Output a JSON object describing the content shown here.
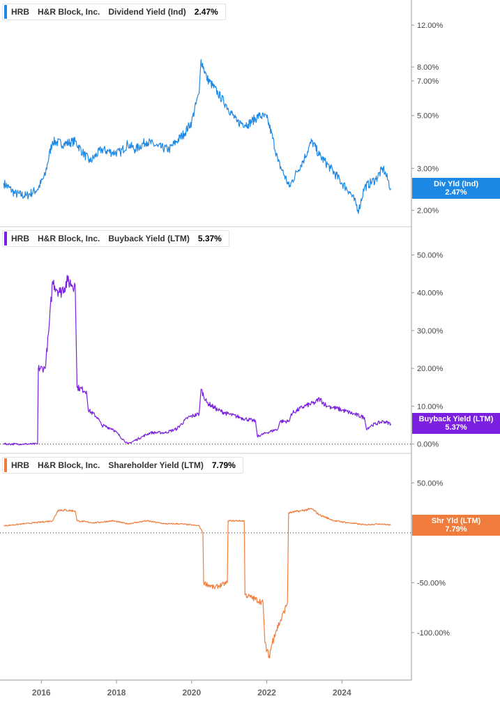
{
  "chart_data": [
    {
      "type": "line",
      "ticker": "HRB",
      "company": "H&R Block, Inc.",
      "metric": "Dividend Yield (Ind)",
      "current_value": "2.47%",
      "badge_label": "Div Yld (Ind)",
      "badge_value": "2.47%",
      "color": "#1e88e5",
      "scale": "log",
      "ylim": [
        1.8,
        14.5
      ],
      "yticks": [
        {
          "v": 12,
          "label": "12.00%"
        },
        {
          "v": 8,
          "label": "8.00%"
        },
        {
          "v": 7,
          "label": "7.00%"
        },
        {
          "v": 5,
          "label": "5.00%"
        },
        {
          "v": 3,
          "label": "3.00%"
        },
        {
          "v": 2,
          "label": "2.00%"
        }
      ],
      "x": [
        2015.0,
        2015.3,
        2015.6,
        2015.9,
        2016.1,
        2016.3,
        2016.6,
        2016.9,
        2017.1,
        2017.3,
        2017.6,
        2017.9,
        2018.1,
        2018.3,
        2018.5,
        2018.8,
        2019.1,
        2019.4,
        2019.6,
        2019.8,
        2020.0,
        2020.2,
        2020.25,
        2020.4,
        2020.7,
        2020.9,
        2021.2,
        2021.5,
        2021.8,
        2022.0,
        2022.3,
        2022.6,
        2022.8,
        2023.0,
        2023.2,
        2023.4,
        2023.7,
        2024.0,
        2024.2,
        2024.45,
        2024.6,
        2024.9,
        2025.1,
        2025.3
      ],
      "values": [
        2.6,
        2.35,
        2.3,
        2.45,
        2.8,
        3.9,
        3.8,
        3.9,
        3.5,
        3.2,
        3.6,
        3.5,
        3.5,
        3.8,
        3.6,
        3.9,
        3.7,
        3.6,
        3.9,
        4.2,
        4.7,
        6.2,
        8.6,
        7.2,
        6.2,
        5.6,
        4.7,
        4.6,
        5.0,
        4.9,
        3.2,
        2.5,
        2.9,
        3.3,
        3.9,
        3.4,
        3.0,
        2.6,
        2.4,
        2.0,
        2.5,
        2.7,
        3.0,
        2.47
      ]
    },
    {
      "type": "line",
      "ticker": "HRB",
      "company": "H&R Block, Inc.",
      "metric": "Buyback Yield (LTM)",
      "current_value": "5.37%",
      "badge_label": "Buyback Yield (LTM)",
      "badge_value": "5.37%",
      "color": "#7b1fe0",
      "ylim": [
        -1,
        56
      ],
      "zero_line": true,
      "yticks": [
        {
          "v": 50,
          "label": "50.00%"
        },
        {
          "v": 40,
          "label": "40.00%"
        },
        {
          "v": 30,
          "label": "30.00%"
        },
        {
          "v": 20,
          "label": "20.00%"
        },
        {
          "v": 10,
          "label": "10.00%"
        },
        {
          "v": 0,
          "label": "0.00%"
        }
      ],
      "x": [
        2015.0,
        2015.9,
        2015.92,
        2016.1,
        2016.2,
        2016.3,
        2016.5,
        2016.7,
        2016.9,
        2016.95,
        2017.2,
        2017.25,
        2017.5,
        2017.6,
        2017.9,
        2018.2,
        2018.3,
        2018.7,
        2018.9,
        2019.3,
        2019.6,
        2019.9,
        2020.2,
        2020.25,
        2020.4,
        2020.7,
        2020.95,
        2021.3,
        2021.7,
        2021.75,
        2022.0,
        2022.3,
        2022.35,
        2022.6,
        2022.65,
        2023.0,
        2023.3,
        2023.4,
        2023.6,
        2023.65,
        2024.0,
        2024.3,
        2024.6,
        2024.65,
        2024.8,
        2025.1,
        2025.3
      ],
      "values": [
        0,
        0,
        20,
        20,
        30,
        43,
        40,
        43,
        42,
        15,
        14,
        9,
        7,
        5,
        4,
        1,
        0,
        2,
        3,
        3,
        4,
        7,
        8,
        14.5,
        11,
        9,
        8,
        7,
        6,
        2,
        3,
        4,
        6,
        6,
        8,
        10,
        11,
        12,
        10,
        10,
        9,
        8,
        7,
        4,
        5,
        6,
        5.37
      ]
    },
    {
      "type": "line",
      "ticker": "HRB",
      "company": "H&R Block, Inc.",
      "metric": "Shareholder Yield (LTM)",
      "current_value": "7.79%",
      "badge_label": "Shr Yld (LTM)",
      "badge_value": "7.79%",
      "color": "#f07c3c",
      "ylim": [
        -142,
        74
      ],
      "zero_line": true,
      "yticks": [
        {
          "v": 50,
          "label": "50.00%"
        },
        {
          "v": 0,
          "label": "0.00%"
        },
        {
          "v": -50,
          "label": "-50.00%"
        },
        {
          "v": -100,
          "label": "-100.00%"
        }
      ],
      "x": [
        2015.0,
        2015.8,
        2016.3,
        2016.45,
        2016.9,
        2016.95,
        2017.4,
        2017.9,
        2018.3,
        2018.8,
        2019.3,
        2019.7,
        2020.2,
        2020.3,
        2020.32,
        2020.6,
        2020.95,
        2020.97,
        2021.4,
        2021.42,
        2021.9,
        2021.95,
        2022.05,
        2022.2,
        2022.4,
        2022.55,
        2022.58,
        2022.9,
        2023.2,
        2023.4,
        2023.8,
        2024.2,
        2024.6,
        2025.0,
        2025.3
      ],
      "values": [
        7,
        10,
        12,
        23,
        22,
        12,
        10,
        12,
        9,
        12,
        9,
        9,
        7,
        0,
        -50,
        -55,
        -50,
        12,
        12,
        -62,
        -70,
        -110,
        -125,
        -102,
        -85,
        -70,
        20,
        22,
        24,
        18,
        12,
        10,
        8,
        9,
        7.79
      ]
    }
  ],
  "x_axis": {
    "ticks": [
      {
        "v": 2016,
        "label": "2016"
      },
      {
        "v": 2018,
        "label": "2018"
      },
      {
        "v": 2020,
        "label": "2020"
      },
      {
        "v": 2022,
        "label": "2022"
      },
      {
        "v": 2024,
        "label": "2024"
      }
    ]
  }
}
